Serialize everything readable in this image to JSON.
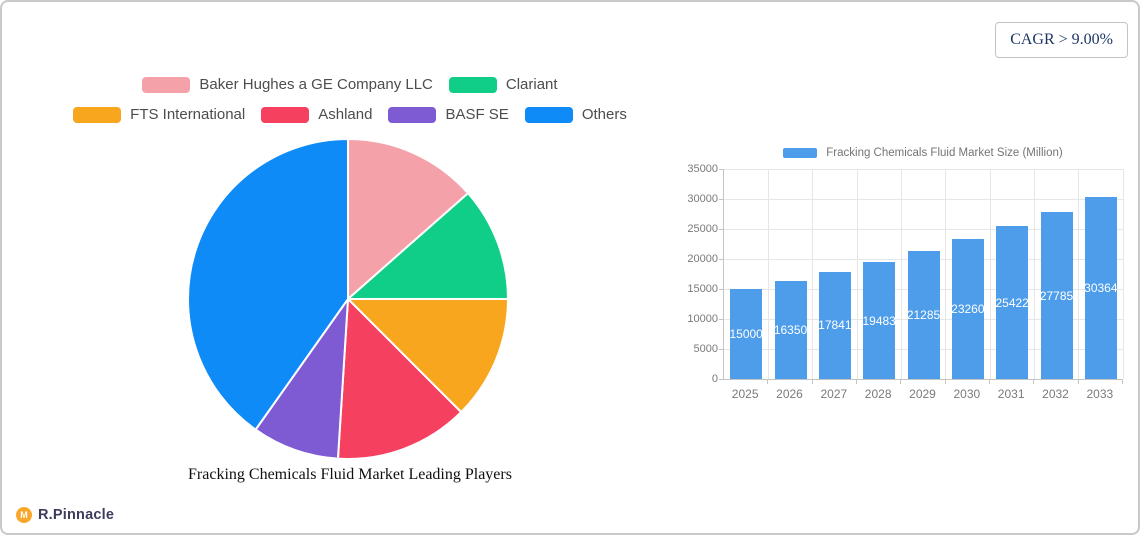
{
  "badge": {
    "label": "CAGR > 9.00%"
  },
  "logo": {
    "text": "R.Pinnacle",
    "icon": "mountain-circle-icon",
    "icon_glyph": "M",
    "icon_color": "#f9a72b"
  },
  "chart_data": [
    {
      "type": "pie",
      "title": "Fracking Chemicals Fluid Market Leading Players",
      "legend_position": "top",
      "slices": [
        {
          "label": "Baker Hughes a GE Company LLC",
          "value_pct": 13.5,
          "color": "#f4a1aa"
        },
        {
          "label": "Clariant",
          "value_pct": 11.5,
          "color": "#10ce87"
        },
        {
          "label": "FTS International",
          "value_pct": 12.5,
          "color": "#f9a61f"
        },
        {
          "label": "Ashland",
          "value_pct": 13.5,
          "color": "#f6405f"
        },
        {
          "label": "BASF SE",
          "value_pct": 8.8,
          "color": "#7e5ad3"
        },
        {
          "label": "Others",
          "value_pct": 40.2,
          "color": "#0e8bf7"
        }
      ]
    },
    {
      "type": "bar",
      "legend": "Fracking Chemicals Fluid Market Size (Million)",
      "categories": [
        "2025",
        "2026",
        "2027",
        "2028",
        "2029",
        "2030",
        "2031",
        "2032",
        "2033"
      ],
      "values": [
        15000,
        16350,
        17841,
        19483,
        21285,
        23260,
        25422,
        27785,
        30364
      ],
      "ylim": [
        0,
        35000
      ],
      "ytick_step": 5000,
      "bar_color": "#4d9dea",
      "grid": true,
      "value_labels": "inside-center-white"
    }
  ]
}
